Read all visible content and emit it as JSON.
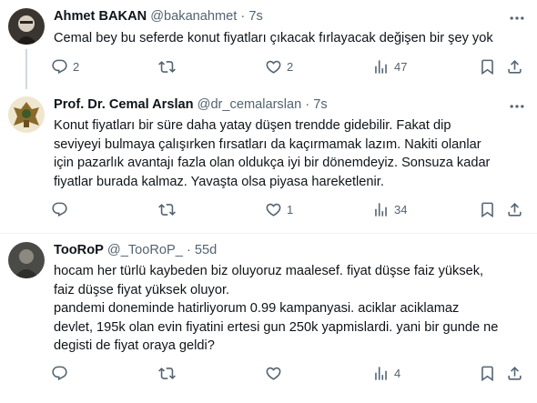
{
  "tweets": [
    {
      "name": "Ahmet BAKAN",
      "handle": "@bakanahmet",
      "dot": "·",
      "time": "7s",
      "lines": [
        "Cemal bey bu seferde konut fiyatları çıkacak  fırlayacak değişen bir şey yok"
      ],
      "replies": "2",
      "retweets": "",
      "likes": "2",
      "views": "47"
    },
    {
      "name": "Prof. Dr. Cemal Arslan",
      "handle": "@dr_cemalarslan",
      "dot": "·",
      "time": "7s",
      "lines": [
        "Konut fiyatları bir süre daha yatay düşen trendde gidebilir. Fakat dip",
        "seviyeyi bulmaya çalışırken fırsatları da kaçırmamak lazım. Nakiti olanlar",
        "için pazarlık avantajı fazla olan oldukça iyi bir dönemdeyiz. Sonsuza kadar",
        "fiyatlar burada kalmaz. Yavaşta olsa piyasa hareketlenir."
      ],
      "replies": "",
      "retweets": "",
      "likes": "1",
      "views": "34"
    },
    {
      "name": "TooRoP",
      "handle": "@_TooRoP_",
      "dot": "·",
      "time": "55d",
      "lines": [
        "hocam her türlü kaybeden biz oluyoruz maalesef. fiyat düşse faiz yüksek,",
        "faiz düşse fiyat yüksek oluyor.",
        "pandemi doneminde hatirliyorum 0.99 kampanyasi. aciklar aciklamaz",
        "devlet, 195k olan evin fiyatini ertesi gun 250k yapmislardi. yani bir gunde ne",
        "degisti de fiyat oraya geldi?"
      ],
      "replies": "",
      "retweets": "",
      "likes": "",
      "views": "4"
    }
  ],
  "icons": {
    "reply": "reply-icon",
    "retweet": "retweet-icon",
    "like": "heart-icon",
    "views": "views-icon",
    "bookmark": "bookmark-icon",
    "share": "share-icon",
    "more": "more-icon"
  },
  "colors": {
    "text": "#0f1419",
    "secondary": "#536471",
    "divider": "#eff3f4",
    "thread_line": "#cfd9de"
  }
}
